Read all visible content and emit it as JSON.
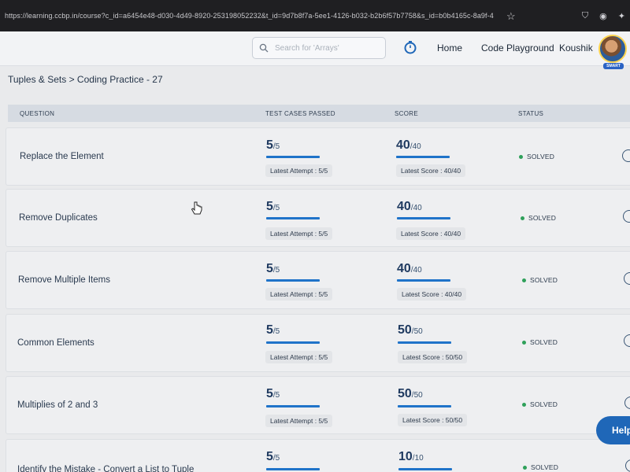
{
  "browser": {
    "url": "https://learning.ccbp.in/course?c_id=a6454e48-d030-4d49-8920-253198052232&t_id=9d7b8f7a-5ee1-4126-b032-b2b6f57b7758&s_id=b0b4165c-8a9f-4"
  },
  "header": {
    "search_placeholder": "Search for 'Arrays'",
    "nav_home": "Home",
    "nav_playground": "Code Playground",
    "user_name": "Koushik",
    "avatar_badge": "SMART"
  },
  "breadcrumb": "Tuples & Sets > Coding Practice - 27",
  "table": {
    "col_question": "QUESTION",
    "col_tests": "TEST CASES PASSED",
    "col_score": "SCORE",
    "col_status": "STATUS"
  },
  "rows": [
    {
      "name": "Replace the Element",
      "passed": "5",
      "total": "/5",
      "latest_attempt": "Latest Attempt : 5/5",
      "score": "40",
      "score_total": "/40",
      "latest_score": "Latest Score : 40/40",
      "status": "SOLVED"
    },
    {
      "name": "Remove Duplicates",
      "passed": "5",
      "total": "/5",
      "latest_attempt": "Latest Attempt : 5/5",
      "score": "40",
      "score_total": "/40",
      "latest_score": "Latest Score : 40/40",
      "status": "SOLVED"
    },
    {
      "name": "Remove Multiple Items",
      "passed": "5",
      "total": "/5",
      "latest_attempt": "Latest Attempt : 5/5",
      "score": "40",
      "score_total": "/40",
      "latest_score": "Latest Score : 40/40",
      "status": "SOLVED"
    },
    {
      "name": "Common Elements",
      "passed": "5",
      "total": "/5",
      "latest_attempt": "Latest Attempt : 5/5",
      "score": "50",
      "score_total": "/50",
      "latest_score": "Latest Score : 50/50",
      "status": "SOLVED"
    },
    {
      "name": "Multiplies of 2 and 3",
      "passed": "5",
      "total": "/5",
      "latest_attempt": "Latest Attempt : 5/5",
      "score": "50",
      "score_total": "/50",
      "latest_score": "Latest Score : 50/50",
      "status": "SOLVED"
    },
    {
      "name": "Identify the Mistake - Convert a List to Tuple",
      "passed": "5",
      "total": "/5",
      "latest_attempt": "",
      "score": "10",
      "score_total": "/10",
      "latest_score": "",
      "status": "SOLVED"
    }
  ],
  "help_label": "Help",
  "colors": {
    "accent": "#1f73c9",
    "solved": "#2ea05a",
    "header_bg": "#d6dbe2"
  }
}
